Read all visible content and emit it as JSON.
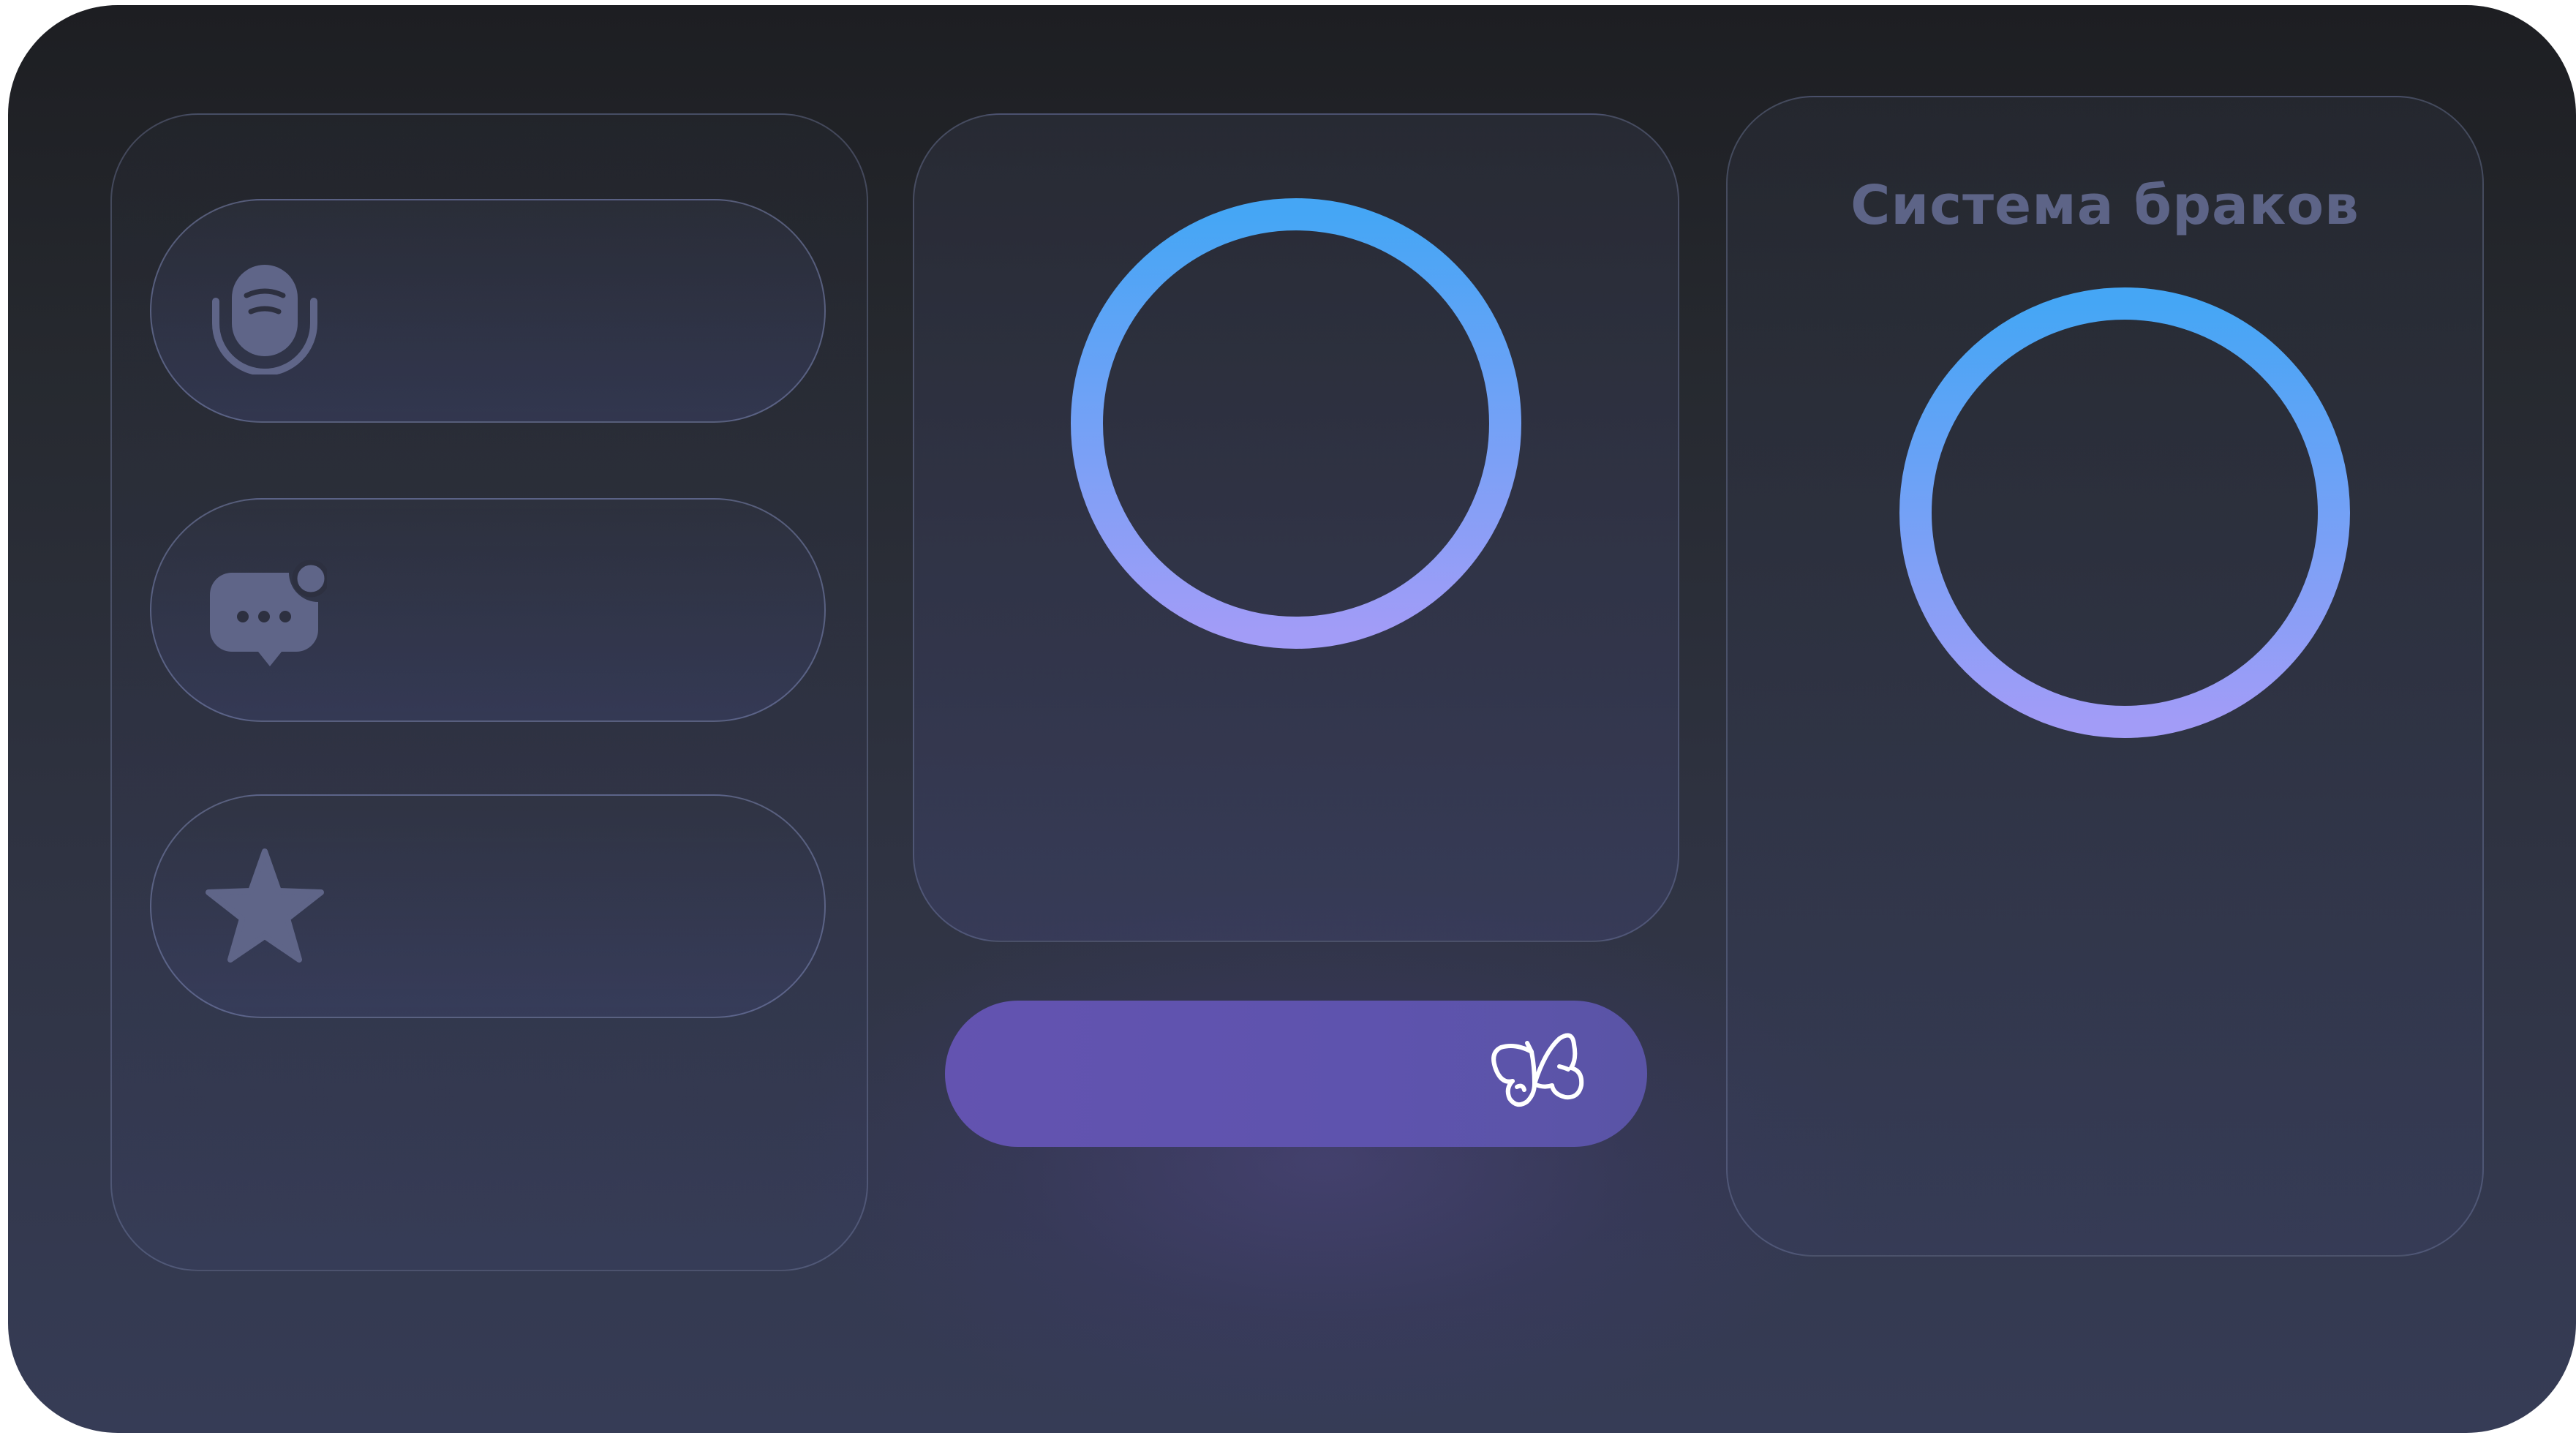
{
  "left_panel": {
    "items": [
      {
        "icon": "microphone-icon"
      },
      {
        "icon": "chat-bubble-notification-icon"
      },
      {
        "icon": "star-icon"
      }
    ]
  },
  "middle_panel": {
    "ring_icon": "ring-progress-indicator"
  },
  "right_panel": {
    "title": "Система браков",
    "ring_icon": "ring-progress-indicator"
  },
  "action_bar": {
    "icon": "butterfly-icon"
  },
  "colors": {
    "ring_gradient_top": "#45a6f5",
    "ring_gradient_bottom": "#a29cf7",
    "action_bar": "#6353b0",
    "title_text": "#5d6487",
    "icon_fill": "#5f6588"
  }
}
